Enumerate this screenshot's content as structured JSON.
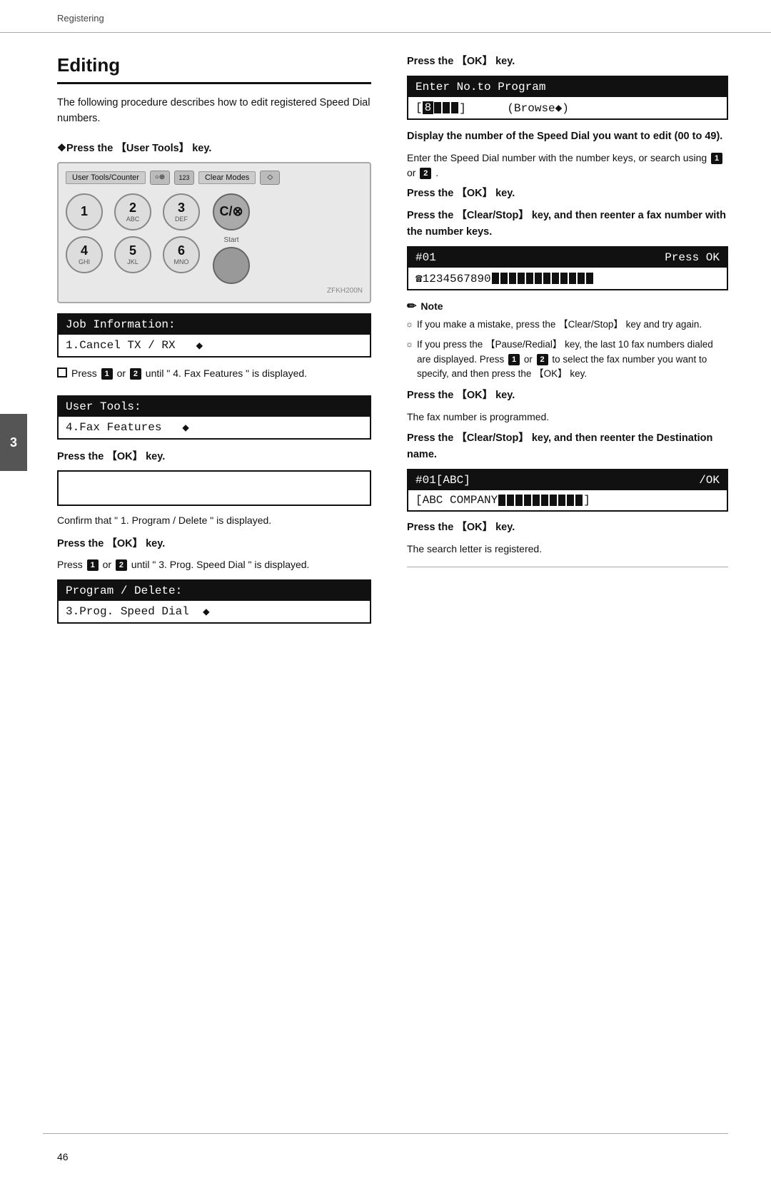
{
  "header": {
    "label": "Registering"
  },
  "side_tab": {
    "number": "3"
  },
  "title": "Editing",
  "intro": "The following procedure describes how to edit registered Speed Dial numbers.",
  "left_column": {
    "step1": {
      "instruction": "Press the 【User Tools】 key.",
      "keypad_label": "User Tools/Counter",
      "zfkh": "ZFKH200N",
      "lcd1_lines": [
        "Job Information:",
        "1.Cancel TX / RX  ◆"
      ],
      "step2_instruction": "Press 1 or 2 until \" 4. Fax Features \" is displayed.",
      "lcd2_lines": [
        "User Tools:",
        "4.Fax Features  ◆"
      ],
      "step3_instruction_bold": "Press the 【OK】 key.",
      "blank_lcd": true,
      "confirm_text": "Confirm that \" 1. Program / Delete \" is displayed.",
      "step4_instruction_bold": "Press the 【OK】 key.",
      "step5_instruction": "Press 1 or 2 until \" 3. Prog. Speed Dial \" is displayed.",
      "lcd3_lines": [
        "Program / Delete:",
        "3.Prog. Speed Dial  ◆"
      ]
    }
  },
  "right_column": {
    "step6_instruction_bold": "Press the 【OK】 key.",
    "lcd_enter": {
      "line1": "Enter No.to Program",
      "line2_left": "[8███]",
      "line2_right": "(Browse◆)"
    },
    "display_instruction_bold": "Display the number of the Speed Dial you want to edit (00 to 49).",
    "display_text": "Enter the Speed Dial number with the number keys, or search using 1 or 2 .",
    "step7_instruction_bold": "Press the 【OK】 key.",
    "step8_instruction_bold": "Press the 【Clear/Stop】 key, and then reenter a fax number with the number keys.",
    "lcd_fax": {
      "line1_left": "#01",
      "line1_right": "Press OK",
      "line2": "☎1234567890████████████"
    },
    "note_title": "Note",
    "note_items": [
      "If you make a mistake, press the 【Clear/Stop】 key and try again.",
      "If you press the 【Pause/Redial】 key, the last 10 fax numbers dialed are displayed. Press 1 or 2 to select the fax number you want to specify, and then press the 【OK】 key."
    ],
    "step9_instruction_bold": "Press the 【OK】 key.",
    "fax_programmed_text": "The fax number is programmed.",
    "step10_instruction_bold": "Press the 【Clear/Stop】 key, and then reenter the Destination name.",
    "lcd_name": {
      "line1_left": "#01[ABC]",
      "line1_right": "/OK",
      "line2": "[ABC COMPANY████████]"
    },
    "step11_instruction_bold": "Press the 【OK】 key.",
    "registered_text": "The search letter is registered."
  },
  "page_number": "46"
}
